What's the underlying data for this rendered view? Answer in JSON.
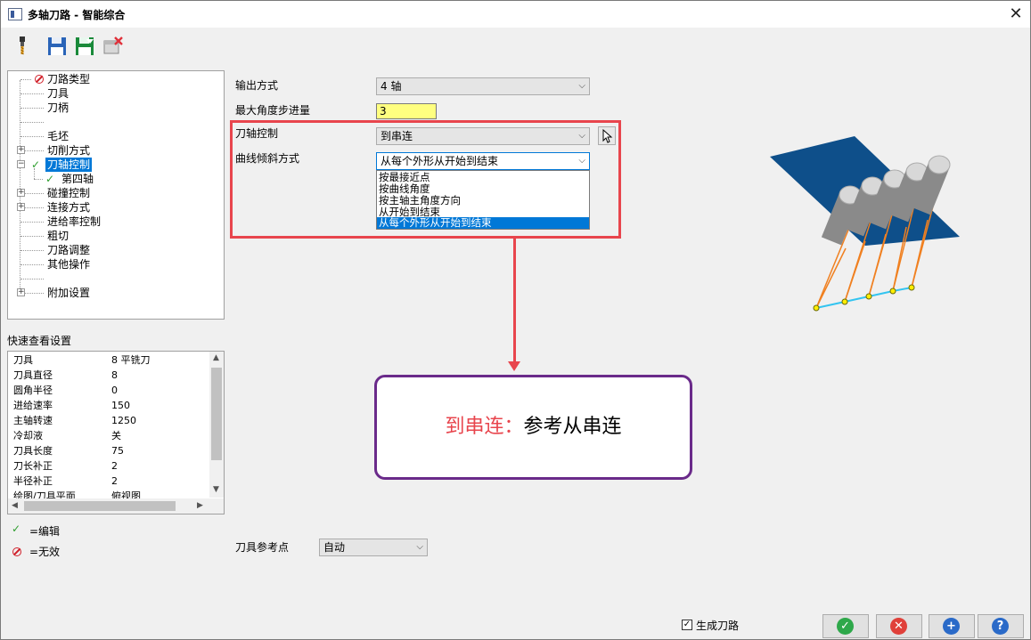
{
  "window": {
    "title": "多轴刀路 - 智能综合",
    "close_glyph": "✕"
  },
  "toolbar": {
    "icons": [
      "tool-icon",
      "save-icon",
      "save-as-icon",
      "delete-icon"
    ]
  },
  "tree": {
    "items": [
      {
        "label": "刀路类型",
        "status": "invalid"
      },
      {
        "label": "刀具"
      },
      {
        "label": "刀柄"
      },
      {
        "label": ""
      },
      {
        "label": "毛坯"
      },
      {
        "label": "切削方式",
        "expandable": true
      },
      {
        "label": "刀轴控制",
        "expandable": true,
        "expanded": true,
        "status": "edited",
        "selected": true
      },
      {
        "label": "第四轴",
        "status": "edited"
      },
      {
        "label": "碰撞控制",
        "expandable": true
      },
      {
        "label": "连接方式",
        "expandable": true
      },
      {
        "label": "进给率控制"
      },
      {
        "label": "粗切"
      },
      {
        "label": "刀路调整"
      },
      {
        "label": "其他操作"
      },
      {
        "label": ""
      },
      {
        "label": "附加设置",
        "expandable": true
      }
    ]
  },
  "quick_view": {
    "title": "快速查看设置",
    "rows": [
      {
        "key": "刀具",
        "value": "8 平铣刀"
      },
      {
        "key": "刀具直径",
        "value": "8"
      },
      {
        "key": "圆角半径",
        "value": "0"
      },
      {
        "key": "进给速率",
        "value": "150"
      },
      {
        "key": "主轴转速",
        "value": "1250"
      },
      {
        "key": "冷却液",
        "value": "关"
      },
      {
        "key": "刀具长度",
        "value": "75"
      },
      {
        "key": "刀长补正",
        "value": "2"
      },
      {
        "key": "半径补正",
        "value": "2"
      },
      {
        "key": "绘图/刀具平面",
        "value": "俯视图"
      }
    ]
  },
  "legend": {
    "edited": "=编辑",
    "invalid": "=无效"
  },
  "form": {
    "output_label": "输出方式",
    "output_value": "4 轴",
    "max_angle_label": "最大角度步进量",
    "max_angle_value": "3",
    "axis_control_label": "刀轴控制",
    "axis_control_value": "到串连",
    "tilt_label": "曲线倾斜方式",
    "tilt_value": "从每个外形从开始到结束",
    "tilt_options": [
      "按最接近点",
      "按曲线角度",
      "按主轴主角度方向",
      "从开始到结束",
      "从每个外形从开始到结束"
    ],
    "tool_ref_label": "刀具参考点",
    "tool_ref_value": "自动"
  },
  "callout": {
    "key": "到串连：",
    "text": "参考从串连"
  },
  "footer": {
    "generate_label": "生成刀路",
    "generate_checked": true
  },
  "colors": {
    "accent": "#e8454d",
    "callout_border": "#6a2a8a",
    "selection": "#0078d7",
    "plane": "#0e4f8a"
  }
}
